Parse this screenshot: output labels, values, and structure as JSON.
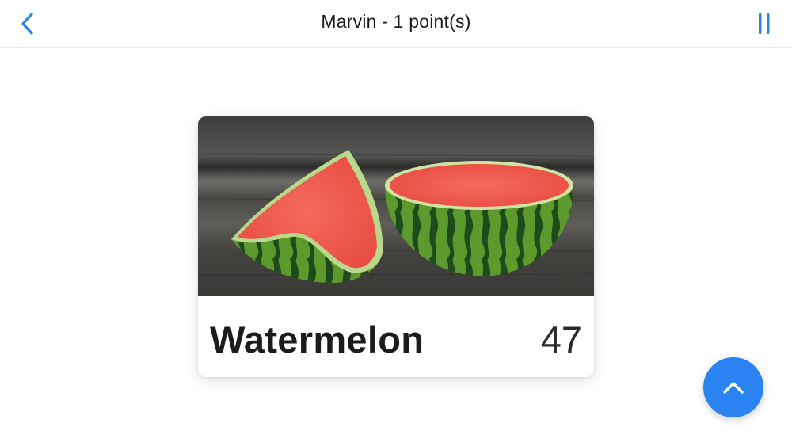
{
  "navbar": {
    "title": "Marvin - 1 point(s)",
    "back_icon": "chevron-left-icon",
    "pause_icon": "pause-icon",
    "accent_color": "#2b82f1"
  },
  "card": {
    "image_subject": "watermelon-photo",
    "name": "Watermelon",
    "score": "47"
  },
  "fab": {
    "icon": "chevron-up-icon",
    "color": "#2b82f1"
  }
}
